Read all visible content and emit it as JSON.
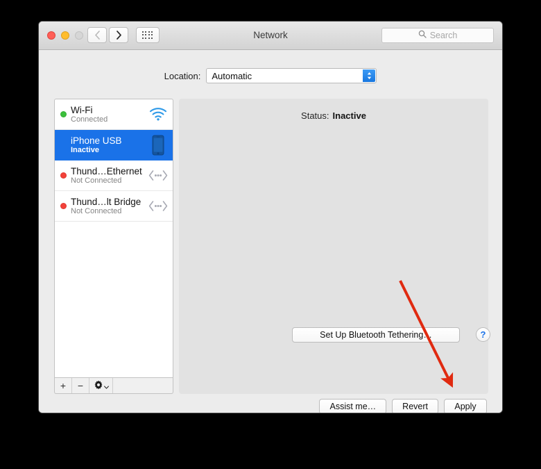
{
  "window": {
    "title": "Network",
    "traffic_lights": [
      "close",
      "minimize",
      "zoom"
    ],
    "nav_back": "back-icon",
    "nav_forward": "forward-icon",
    "show_all": "grid-icon"
  },
  "search": {
    "placeholder": "Search",
    "value": "",
    "icon": "search-icon"
  },
  "location": {
    "label": "Location:",
    "value": "Automatic",
    "options": [
      "Automatic"
    ]
  },
  "services": [
    {
      "name": "Wi-Fi",
      "state": "Connected",
      "dot": "green",
      "icon": "wifi-icon",
      "selected": false
    },
    {
      "name": "iPhone USB",
      "state": "Inactive",
      "dot": "none",
      "icon": "iphone-icon",
      "selected": true
    },
    {
      "name": "Thund…Ethernet",
      "state": "Not Connected",
      "dot": "red",
      "icon": "thunderbolt-icon",
      "selected": false
    },
    {
      "name": "Thund…lt Bridge",
      "state": "Not Connected",
      "dot": "red",
      "icon": "thunderbolt-icon",
      "selected": false
    }
  ],
  "list_toolbar": {
    "add": "+",
    "remove": "−",
    "actions": "gear-icon"
  },
  "detail": {
    "status_label": "Status:",
    "status_value": "Inactive",
    "tethering_button": "Set Up Bluetooth Tethering…",
    "help_button": "?"
  },
  "footer": {
    "assist": "Assist me…",
    "revert": "Revert",
    "apply": "Apply"
  },
  "annotation": {
    "type": "arrow",
    "color": "#e02a10",
    "points_to": "apply-button"
  },
  "colors": {
    "selection_blue": "#1a72e8",
    "accent_blue": "#1877e0",
    "status_green": "#3cc03c",
    "status_red": "#f4423a",
    "annotation_red": "#e02a10",
    "window_bg": "#ececec",
    "panel_bg": "#e2e2e2"
  }
}
